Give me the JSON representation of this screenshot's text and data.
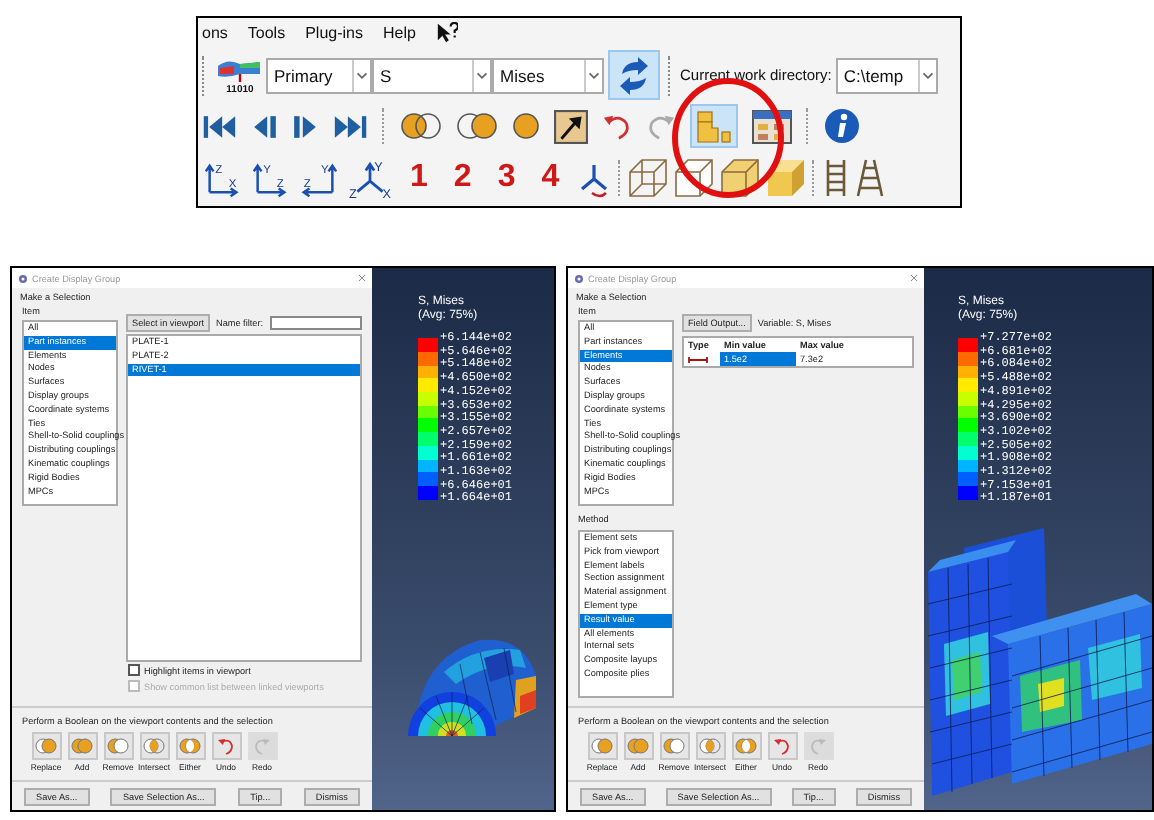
{
  "toolbar_window": {
    "menu": [
      "ons",
      "Tools",
      "Plug-ins",
      "Help"
    ],
    "icon_caption": "11010",
    "combos": [
      "Primary",
      "S",
      "Mises"
    ],
    "work_directory": {
      "label": "Current work directory:",
      "value": "C:\\temp"
    },
    "view_axes": [
      {
        "kind": "front",
        "labels": [
          "Z",
          "X"
        ]
      },
      {
        "kind": "side",
        "labels": [
          "Y",
          "Z"
        ]
      },
      {
        "kind": "mirror",
        "labels": [
          "Z",
          "Y"
        ]
      },
      {
        "kind": "iso",
        "labels": [
          "Y",
          "Z",
          "X"
        ]
      }
    ],
    "view_numbers": [
      "1",
      "2",
      "3",
      "4"
    ]
  },
  "dialogs": [
    {
      "title": "Create Display Group",
      "section": "Make a Selection",
      "item_label": "Item",
      "items": [
        {
          "label": "All",
          "selected": false
        },
        {
          "label": "Part instances",
          "selected": true
        },
        {
          "label": "Elements",
          "selected": false
        },
        {
          "label": "Nodes",
          "selected": false
        },
        {
          "label": "Surfaces",
          "selected": false
        },
        {
          "label": "Display groups",
          "selected": false
        },
        {
          "label": "Coordinate systems",
          "selected": false
        },
        {
          "label": "Ties",
          "selected": false
        },
        {
          "label": "Shell-to-Solid couplings",
          "selected": false
        },
        {
          "label": "Distributing couplings",
          "selected": false
        },
        {
          "label": "Kinematic couplings",
          "selected": false
        },
        {
          "label": "Rigid Bodies",
          "selected": false
        },
        {
          "label": "MPCs",
          "selected": false
        }
      ],
      "selector": {
        "kind": "names",
        "button": "Select in viewport",
        "filter_label": "Name filter:",
        "names": [
          {
            "label": "PLATE-1",
            "selected": false
          },
          {
            "label": "PLATE-2",
            "selected": false
          },
          {
            "label": "RIVET-1",
            "selected": true
          }
        ],
        "checks": [
          {
            "label": "Highlight items in viewport",
            "checked": false,
            "disabled": false
          },
          {
            "label": "Show common list between linked viewports",
            "checked": false,
            "disabled": true
          }
        ]
      },
      "boolean_label": "Perform a Boolean on the viewport contents and the selection",
      "boolean_buttons": [
        {
          "kind": "replace",
          "label": "Replace",
          "disabled": false
        },
        {
          "kind": "add",
          "label": "Add",
          "disabled": false
        },
        {
          "kind": "remove",
          "label": "Remove",
          "disabled": false
        },
        {
          "kind": "intersect",
          "label": "Intersect",
          "disabled": false
        },
        {
          "kind": "either",
          "label": "Either",
          "disabled": false
        },
        {
          "kind": "undo",
          "label": "Undo",
          "disabled": false
        },
        {
          "kind": "redo",
          "label": "Redo",
          "disabled": true
        }
      ],
      "buttons": [
        "Save As...",
        "Save Selection As...",
        "Tip...",
        "Dismiss"
      ],
      "viewport": {
        "legend": {
          "title": "S, Mises",
          "note": "(Avg: 75%)",
          "values": [
            "+6.144e+02",
            "+5.646e+02",
            "+5.148e+02",
            "+4.650e+02",
            "+4.152e+02",
            "+3.653e+02",
            "+3.155e+02",
            "+2.657e+02",
            "+2.159e+02",
            "+1.661e+02",
            "+1.163e+02",
            "+6.646e+01",
            "+1.664e+01"
          ]
        },
        "model": {
          "kind": "rivet"
        }
      }
    },
    {
      "title": "Create Display Group",
      "section": "Make a Selection",
      "item_label": "Item",
      "items": [
        {
          "label": "All",
          "selected": false
        },
        {
          "label": "Part instances",
          "selected": false
        },
        {
          "label": "Elements",
          "selected": true
        },
        {
          "label": "Nodes",
          "selected": false
        },
        {
          "label": "Surfaces",
          "selected": false
        },
        {
          "label": "Display groups",
          "selected": false
        },
        {
          "label": "Coordinate systems",
          "selected": false
        },
        {
          "label": "Ties",
          "selected": false
        },
        {
          "label": "Shell-to-Solid couplings",
          "selected": false
        },
        {
          "label": "Distributing couplings",
          "selected": false
        },
        {
          "label": "Kinematic couplings",
          "selected": false
        },
        {
          "label": "Rigid Bodies",
          "selected": false
        },
        {
          "label": "MPCs",
          "selected": false
        }
      ],
      "method_label": "Method",
      "methods": [
        {
          "label": "Element sets",
          "selected": false
        },
        {
          "label": "Pick from viewport",
          "selected": false
        },
        {
          "label": "Element labels",
          "selected": false
        },
        {
          "label": "Section assignment",
          "selected": false
        },
        {
          "label": "Material assignment",
          "selected": false
        },
        {
          "label": "Element type",
          "selected": false
        },
        {
          "label": "Result value",
          "selected": true
        },
        {
          "label": "All elements",
          "selected": false
        },
        {
          "label": "Internal sets",
          "selected": false
        },
        {
          "label": "Composite layups",
          "selected": false
        },
        {
          "label": "Composite plies",
          "selected": false
        }
      ],
      "selector": {
        "kind": "result",
        "button": "Field Output...",
        "variable": "Variable: S, Mises",
        "columns": [
          "Type",
          "Min value",
          "Max value"
        ],
        "min": "1.5e2",
        "min_selected": true,
        "max": "7.3e2"
      },
      "boolean_label": "Perform a Boolean on the viewport contents and the selection",
      "boolean_buttons": [
        {
          "kind": "replace",
          "label": "Replace",
          "disabled": false
        },
        {
          "kind": "add",
          "label": "Add",
          "disabled": false
        },
        {
          "kind": "remove",
          "label": "Remove",
          "disabled": false
        },
        {
          "kind": "intersect",
          "label": "Intersect",
          "disabled": false
        },
        {
          "kind": "either",
          "label": "Either",
          "disabled": false
        },
        {
          "kind": "undo",
          "label": "Undo",
          "disabled": false
        },
        {
          "kind": "redo",
          "label": "Redo",
          "disabled": true
        }
      ],
      "buttons": [
        "Save As...",
        "Save Selection As...",
        "Tip...",
        "Dismiss"
      ],
      "viewport": {
        "legend": {
          "title": "S, Mises",
          "note": "(Avg: 75%)",
          "values": [
            "+7.277e+02",
            "+6.681e+02",
            "+6.084e+02",
            "+5.488e+02",
            "+4.891e+02",
            "+4.295e+02",
            "+3.690e+02",
            "+3.102e+02",
            "+2.505e+02",
            "+1.908e+02",
            "+1.312e+02",
            "+7.153e+01",
            "+1.187e+01"
          ]
        },
        "model": {
          "kind": "plate"
        }
      }
    }
  ]
}
